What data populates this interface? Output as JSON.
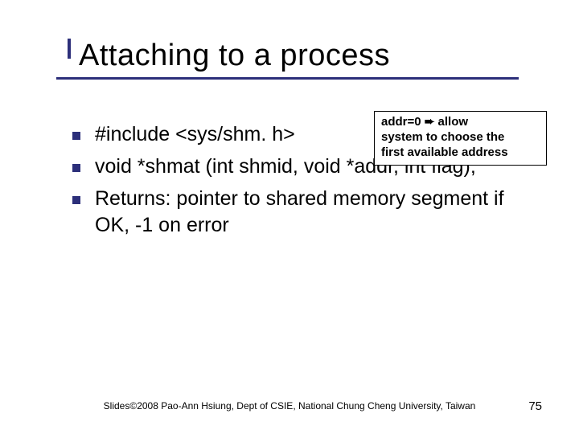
{
  "title": "Attaching to a process",
  "callout": {
    "line1_prefix": "addr=0 ",
    "arrow": "➨",
    "line1_suffix": " allow",
    "line2": "system to choose the",
    "line3": "first available address"
  },
  "bullets": [
    "#include <sys/shm. h>",
    "void *shmat (int shmid, void *addr, int flag);",
    "Returns: pointer to shared memory segment if OK, -1 on error"
  ],
  "footer": "Slides©2008 Pao-Ann Hsiung, Dept of CSIE, National Chung Cheng University, Taiwan",
  "page": "75"
}
